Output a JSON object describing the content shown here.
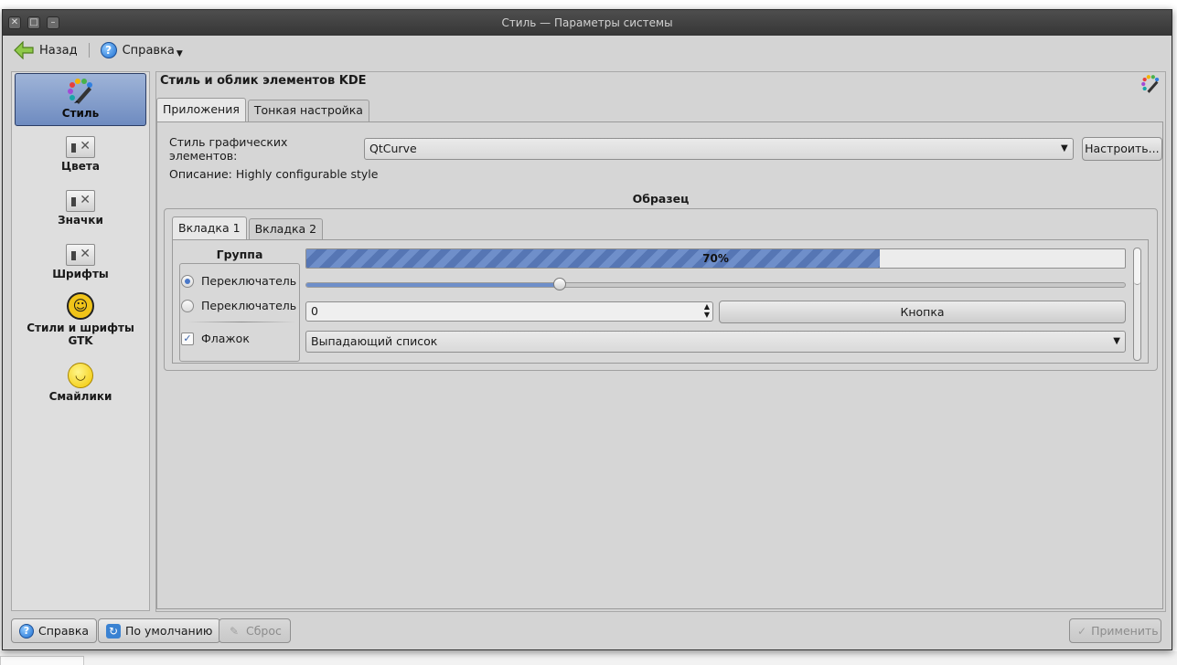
{
  "window": {
    "title": "Стиль — Параметры системы"
  },
  "toolbar": {
    "back_label": "Назад",
    "help_label": "Справка"
  },
  "sidebar": {
    "items": [
      {
        "label": "Стиль",
        "icon": "style-brush-icon",
        "active": true
      },
      {
        "label": "Цвета",
        "icon": "colors-tool-icon"
      },
      {
        "label": "Значки",
        "icon": "icons-tool-icon"
      },
      {
        "label": "Шрифты",
        "icon": "fonts-tool-icon"
      },
      {
        "label": "Стили и шрифты GTK",
        "icon": "gtk-icon"
      },
      {
        "label": "Смайлики",
        "icon": "smiley-icon"
      }
    ]
  },
  "main": {
    "title": "Стиль и облик элементов KDE",
    "tabs": [
      {
        "label": "Приложения",
        "active": true
      },
      {
        "label": "Тонкая настройка"
      }
    ],
    "widget_style_label": "Стиль графических элементов:",
    "widget_style_value": "QtCurve",
    "configure_label": "Настроить...",
    "description": "Описание: Highly configurable style",
    "sample": {
      "title": "Образец",
      "tabs": [
        {
          "label": "Вкладка 1",
          "active": true
        },
        {
          "label": "Вкладка 2"
        }
      ],
      "group_title": "Группа",
      "radio1": "Переключатель",
      "radio2": "Переключатель",
      "checkbox": "Флажок",
      "progress_text": "70%",
      "progress_value": 70,
      "slider_value": 0.31,
      "spin_value": "0",
      "button": "Кнопка",
      "combo": "Выпадающий список"
    }
  },
  "bottom": {
    "help": "Справка",
    "defaults": "По умолчанию",
    "reset": "Сброс",
    "apply": "Применить"
  },
  "colors": {
    "accent": "#6e8bc0",
    "titlebar": "#3e3e3e",
    "window_bg": "#d4d4d4"
  }
}
